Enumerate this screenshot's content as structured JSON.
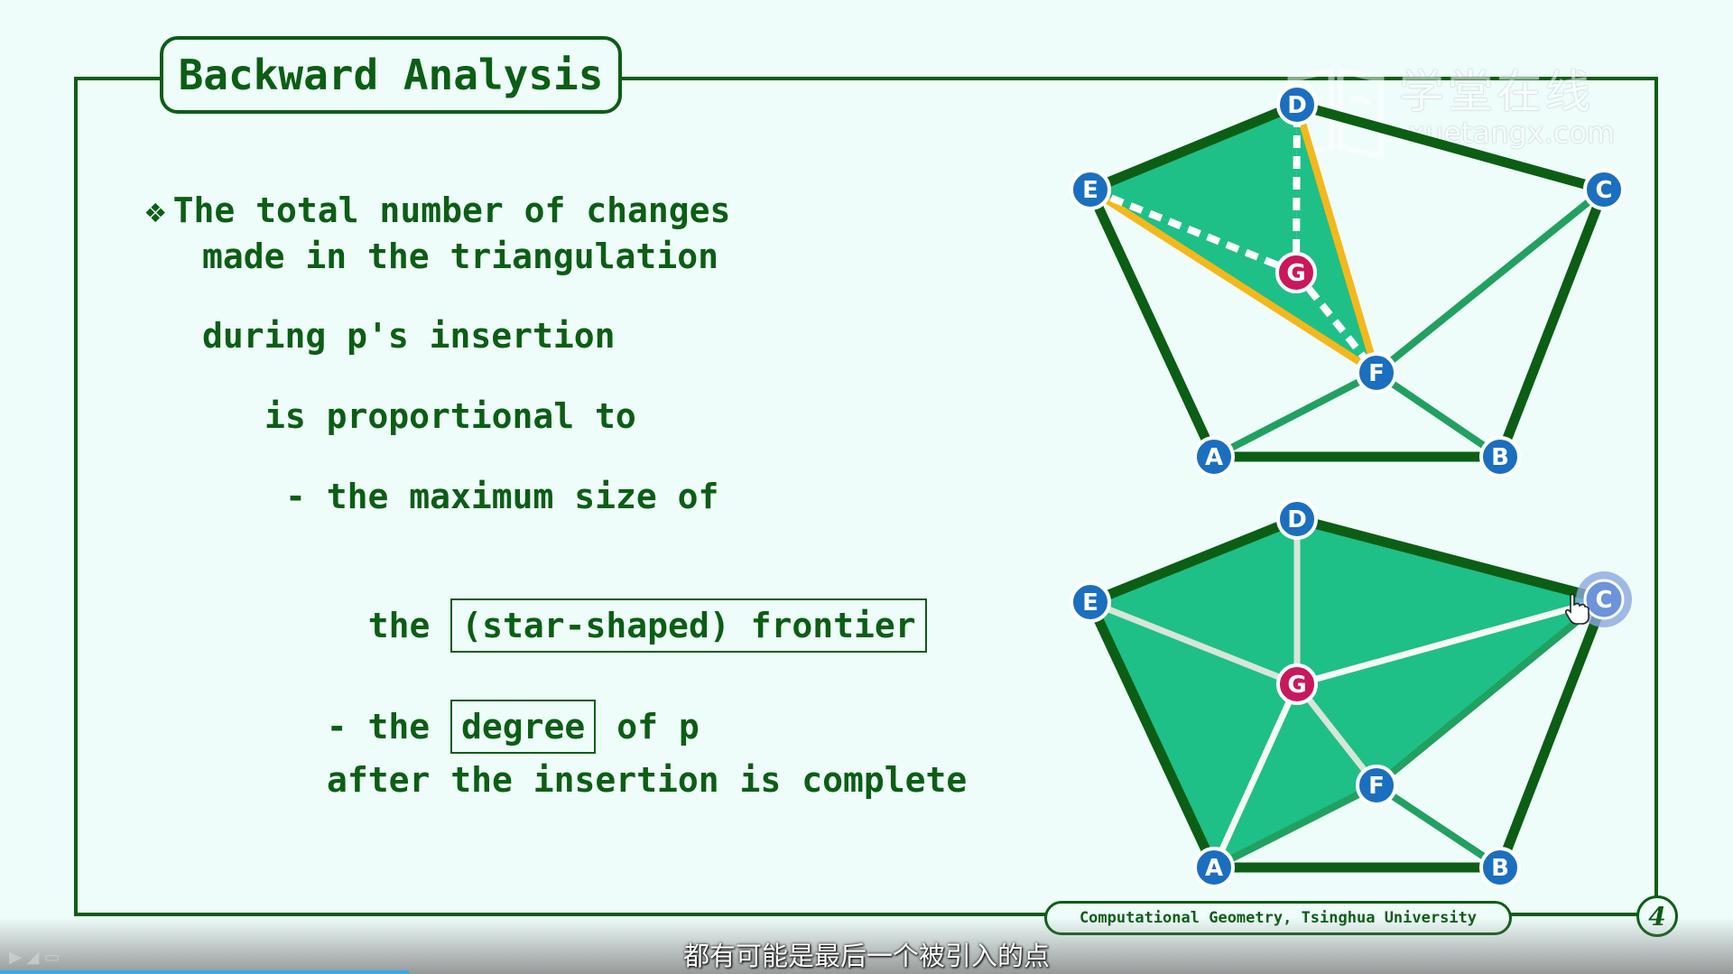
{
  "slide": {
    "title": "Backward Analysis",
    "bullet_glyph": "❖",
    "lines": [
      "The total number of changes",
      "made in the triangulation",
      "during p's insertion",
      "is proportional to",
      "- the maximum size of"
    ],
    "frontier_line": {
      "prefix": "the ",
      "boxed": "(star-shaped) frontier"
    },
    "degree_line": {
      "prefix": "- the ",
      "boxed": "degree",
      "suffix": " of p"
    },
    "last_line": "after the insertion is complete",
    "footer": "Computational Geometry, Tsinghua University",
    "page_number": "4"
  },
  "diagrams": {
    "top_nodes": [
      "D",
      "E",
      "C",
      "G",
      "F",
      "A",
      "B"
    ],
    "bottom_nodes": [
      "D",
      "E",
      "C",
      "G",
      "F",
      "A",
      "B"
    ]
  },
  "watermark": {
    "chinese": "学堂在线",
    "site": "xuetangx.com"
  },
  "player": {
    "subtitle": "都有可能是最后一个被引入的点"
  },
  "colors": {
    "dark_green": "#0b5e14",
    "face_green": "#1fbf88",
    "edge_green": "#22a060",
    "highlight_yellow": "#f4b81c",
    "node_blue": "#1b6fbf",
    "node_magenta": "#c8185e",
    "background": "#eefcfa"
  }
}
